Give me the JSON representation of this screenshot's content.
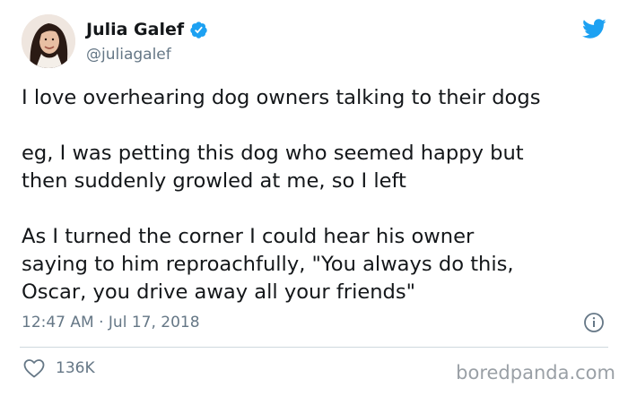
{
  "author": {
    "display_name": "Julia Galef",
    "handle": "@juliagalef",
    "verified": true
  },
  "tweet": {
    "paragraphs": [
      "I love overhearing dog owners talking to their dogs",
      "eg, I was petting this dog who seemed happy but\nthen suddenly growled at me, so I left",
      "As I turned the corner I could hear his owner\nsaying to him reproachfully, \"You always do this,\nOscar, you drive away all your friends\""
    ],
    "timestamp": "12:47 AM · Jul 17, 2018",
    "like_count": "136K"
  },
  "icons": {
    "verified": "verified-badge-icon",
    "platform_logo": "twitter-bird-icon",
    "info": "info-icon",
    "like": "heart-icon"
  },
  "colors": {
    "brand_blue": "#1da1f2",
    "text_primary": "#14171a",
    "text_secondary": "#657786",
    "divider": "#cfd9de"
  },
  "watermark": "boredpanda.com"
}
